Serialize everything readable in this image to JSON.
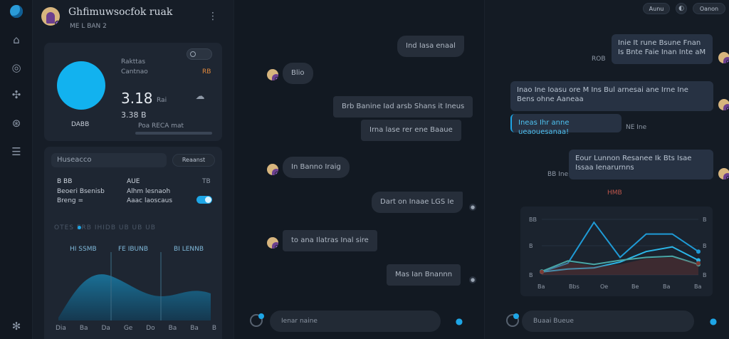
{
  "header": {
    "title": "Ghfimuwsocfok ruak",
    "subtitle": "ME L BAN 2"
  },
  "stats_card": {
    "pill": "",
    "label_a": "Rakttas",
    "label_b": "Cantnao",
    "badge": "RB",
    "value_main": "3.18",
    "value_unit": "Rai",
    "value_sub": "3.38 B",
    "circle_label": "DABB",
    "bar_label": "Poa  RECA mat"
  },
  "panel": {
    "tab_main": "Huseacco",
    "tab_alt": "Reaanst",
    "rows": [
      {
        "k": "B BB",
        "v": "AUE",
        "r": "TB"
      },
      {
        "k": "Beoeri Bsenisb",
        "v": "Alhm lesnaoh",
        "r": ""
      },
      {
        "k": "Breng =",
        "v": "Aaac laoscaus",
        "r": ""
      }
    ],
    "filters": "OTES  ERB  IHIDB  UB  UB  UB",
    "col_labels": [
      "HI SSMB",
      "FE IBUNB",
      "BI LENNB"
    ],
    "x_ticks": [
      "Dia",
      "Ba",
      "Da",
      "Ge",
      "Do",
      "Ba",
      "Ba",
      "B"
    ]
  },
  "chat": {
    "messages": [
      {
        "text": "Ind Iasa  enaal",
        "side": "out"
      },
      {
        "text": "Blio",
        "side": "in"
      },
      {
        "text": "Brb Banine Iad  arsb Shans  it  Ineus",
        "side": "out"
      },
      {
        "text": "Irna  lase rer ene Baaue",
        "side": "out"
      },
      {
        "text": "In Banno Iraig",
        "side": "in"
      },
      {
        "text": "Dart on Inaae LGS  Ie",
        "side": "out"
      },
      {
        "text": "to ana Ilatras  Inal sire",
        "side": "in"
      },
      {
        "text": "Mas Ian Bnannn",
        "side": "out"
      }
    ],
    "composer_placeholder": "Ienar naine"
  },
  "right": {
    "top_btn_a": "Aunu",
    "top_btn_b": "Oanon",
    "msgs": [
      {
        "text": "Inie It rune Bsune Fnan Is  Bnte Faie Inan  Inte  aM",
        "time": "ROB"
      },
      {
        "text": "Inao  Ine Ioasu  ore  M  Ins  Bul  arnesai  ane  Irne Ine Bens ohne  Aaneaa",
        "time": ""
      },
      {
        "text": "Ineas  Ihr  anne  ueaouesanaa!",
        "time": "NE Ine",
        "accent": true
      },
      {
        "text": "Eour  Lunnon  Resanee  Ik  Bts  Isae  Issaa  Ienarurnns",
        "time": "BB Ine"
      }
    ],
    "chart_title": "HMB",
    "composer_placeholder": "Buaai  Bueue"
  },
  "chart_data": {
    "type": "line",
    "title": "HMB",
    "categories": [
      "Ba",
      "Bbs",
      "Oe",
      "Be",
      "Ba",
      "Ba"
    ],
    "ylabels_left": [
      "BB",
      "B",
      "B"
    ],
    "ylabels_right": [
      "B",
      "B",
      "B"
    ],
    "ylim": [
      0,
      100
    ],
    "series": [
      {
        "color": "#1f9bd6",
        "values": [
          5,
          20,
          90,
          30,
          70,
          70,
          40
        ]
      },
      {
        "color": "#2bb7e9",
        "values": [
          5,
          10,
          12,
          22,
          40,
          48,
          25
        ]
      },
      {
        "color": "#4aa6a5",
        "values": [
          6,
          24,
          18,
          25,
          30,
          32,
          18
        ]
      },
      {
        "color": "#7d3a34",
        "values": [
          5,
          22,
          15,
          18,
          28,
          30,
          20
        ]
      }
    ]
  },
  "colors": {
    "accent": "#1ea6e6",
    "bg": "#141b25",
    "card": "#1e2632"
  }
}
